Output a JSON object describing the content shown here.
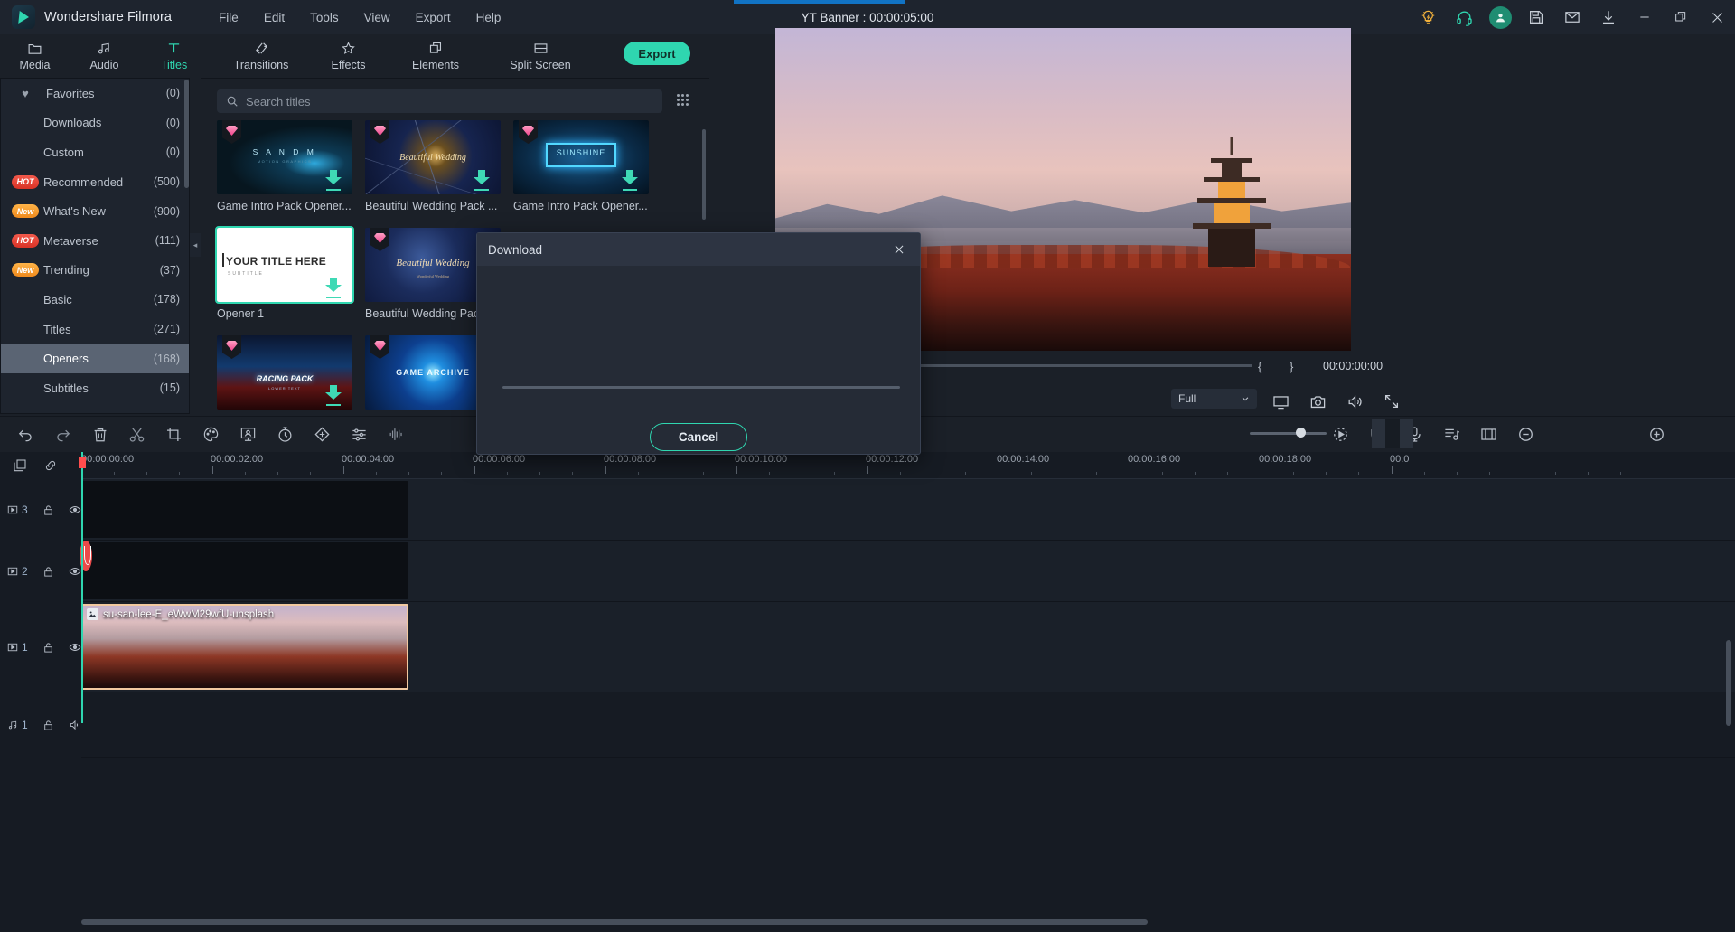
{
  "app": {
    "name": "Wondershare Filmora",
    "logo_icon": "filmora-dart-icon",
    "project_title": "YT Banner : 00:00:05:00"
  },
  "menubar": {
    "items": [
      {
        "label": "File",
        "name": "menu-file"
      },
      {
        "label": "Edit",
        "name": "menu-edit"
      },
      {
        "label": "Tools",
        "name": "menu-tools"
      },
      {
        "label": "View",
        "name": "menu-view"
      },
      {
        "label": "Export",
        "name": "menu-export"
      },
      {
        "label": "Help",
        "name": "menu-help"
      }
    ]
  },
  "titlebar_icons": [
    {
      "name": "tips-lightbulb-icon",
      "color": "#f0b03c"
    },
    {
      "name": "headset-support-icon",
      "color": "#2fd6b0"
    },
    {
      "name": "user-account-icon",
      "color": "#1f8d72"
    },
    {
      "name": "save-project-icon",
      "color": "#c9d0d9"
    },
    {
      "name": "mail-icon",
      "color": "#c9d0d9"
    },
    {
      "name": "download-icon",
      "color": "#c9d0d9"
    },
    {
      "name": "minimize-icon",
      "color": "#c9d0d9"
    },
    {
      "name": "maximize-icon",
      "color": "#c9d0d9"
    },
    {
      "name": "close-icon",
      "color": "#c9d0d9"
    }
  ],
  "ribbon": {
    "tabs": [
      {
        "label": "Media",
        "icon": "folder-icon",
        "active": false
      },
      {
        "label": "Audio",
        "icon": "music-note-icon",
        "active": false
      },
      {
        "label": "Titles",
        "icon": "text-t-icon",
        "active": true
      },
      {
        "label": "Transitions",
        "icon": "transitions-arrows-icon",
        "active": false
      },
      {
        "label": "Effects",
        "icon": "effects-star-icon",
        "active": false
      },
      {
        "label": "Elements",
        "icon": "elements-layers-icon",
        "active": false
      },
      {
        "label": "Split Screen",
        "icon": "split-screen-icon",
        "active": false
      }
    ],
    "export_button": "Export",
    "accent_color": "#2fd6b0"
  },
  "sidebar": {
    "items": [
      {
        "label": "Favorites",
        "count": "(0)",
        "badge": "",
        "icon": "heart-icon",
        "selected": false
      },
      {
        "label": "Downloads",
        "count": "(0)",
        "badge": "",
        "icon": "",
        "selected": false
      },
      {
        "label": "Custom",
        "count": "(0)",
        "badge": "",
        "icon": "",
        "selected": false
      },
      {
        "label": "Recommended",
        "count": "(500)",
        "badge": "HOT",
        "icon": "",
        "selected": false
      },
      {
        "label": "What's New",
        "count": "(900)",
        "badge": "New",
        "icon": "",
        "selected": false
      },
      {
        "label": "Metaverse",
        "count": "(111)",
        "badge": "HOT",
        "icon": "",
        "selected": false
      },
      {
        "label": "Trending",
        "count": "(37)",
        "badge": "New",
        "icon": "",
        "selected": false
      },
      {
        "label": "Basic",
        "count": "(178)",
        "badge": "",
        "icon": "",
        "selected": false
      },
      {
        "label": "Titles",
        "count": "(271)",
        "badge": "",
        "icon": "",
        "selected": false
      },
      {
        "label": "Openers",
        "count": "(168)",
        "badge": "",
        "icon": "",
        "selected": true
      },
      {
        "label": "Subtitles",
        "count": "(15)",
        "badge": "",
        "icon": "",
        "selected": false
      }
    ],
    "badge_colors": {
      "hot": "#e23b2c",
      "new": "#f4992a"
    },
    "selected_bg": "#5a6473",
    "collapse_icon": "chevron-left-icon"
  },
  "library": {
    "search_placeholder": "Search titles",
    "search_value": "",
    "search_icon": "search-icon",
    "grid_view_icon": "grid-view-icon",
    "items": [
      {
        "caption": "Game Intro Pack Opener...",
        "art": "art-sandom",
        "premium": true,
        "downloadable": true,
        "selected": false
      },
      {
        "caption": "Beautiful Wedding Pack ...",
        "art": "art-wed1",
        "premium": true,
        "downloadable": true,
        "selected": false
      },
      {
        "caption": "Game Intro Pack Opener...",
        "art": "art-sun",
        "premium": true,
        "downloadable": true,
        "selected": false
      },
      {
        "caption": "Opener 1",
        "art": "art-white",
        "premium": false,
        "downloadable": true,
        "selected": true
      },
      {
        "caption": "Beautiful Wedding Pac",
        "art": "art-wed2",
        "premium": true,
        "downloadable": false,
        "selected": false
      },
      {
        "caption": "",
        "art": "art-racing",
        "premium": true,
        "downloadable": true,
        "selected": false
      },
      {
        "caption": "",
        "art": "art-gamearc",
        "premium": true,
        "downloadable": false,
        "selected": false
      }
    ],
    "thumb_texts": {
      "sandom": "S A N D M",
      "sandom_sub": "MOTION GRAPHICS",
      "wedding_script": "Beautiful Wedding",
      "wedding_sub": "Wonderful Wedding",
      "sunshine": "SUNSHINE",
      "your_title": "YOUR TITLE HERE",
      "your_title_sub": "SUBTITLE",
      "racing": "RACING PACK",
      "racing_sub": "LOWER TEXT",
      "game_archive": "GAME ARCHIVE"
    }
  },
  "dialog": {
    "title": "Download",
    "cancel_label": "Cancel",
    "close_icon": "close-icon",
    "progress_percent": 0
  },
  "preview": {
    "time_current": "00:00:00:00",
    "bracket_in": "{",
    "bracket_out": "}",
    "quality_label": "Full",
    "quality_caret": "chevron-down-icon",
    "controls": [
      {
        "name": "fullscreen-preview-icon"
      },
      {
        "name": "snapshot-camera-icon"
      },
      {
        "name": "volume-icon"
      },
      {
        "name": "expand-arrows-icon"
      }
    ]
  },
  "timeline_toolbar": {
    "left_tools": [
      {
        "name": "undo-icon"
      },
      {
        "name": "redo-icon"
      },
      {
        "name": "delete-trash-icon"
      },
      {
        "name": "split-scissors-icon"
      },
      {
        "name": "crop-icon"
      },
      {
        "name": "color-palette-icon"
      },
      {
        "name": "green-screen-icon"
      },
      {
        "name": "speed-timer-icon"
      },
      {
        "name": "keyframe-diamond-icon"
      },
      {
        "name": "audio-mixer-icon"
      },
      {
        "name": "audio-waveform-icon"
      }
    ],
    "right_tools": [
      {
        "name": "render-preview-icon"
      },
      {
        "name": "marker-shield-icon"
      },
      {
        "name": "record-voiceover-icon"
      },
      {
        "name": "auto-beat-sync-icon"
      },
      {
        "name": "fit-timeline-icon"
      },
      {
        "name": "zoom-out-icon"
      },
      {
        "name": "zoom-in-icon"
      }
    ],
    "zoom_value": 60
  },
  "timeline": {
    "ruler_labels": [
      "00:00:00:00",
      "00:00:02:00",
      "00:00:04:00",
      "00:00:06:00",
      "00:00:08:00",
      "00:00:10:00",
      "00:00:12:00",
      "00:00:14:00",
      "00:00:16:00",
      "00:00:18:00",
      "00:0"
    ],
    "tracks": [
      {
        "number": "3",
        "type": "video",
        "lock_icon": "unlock-icon",
        "eye_icon": "eye-icon",
        "has_clip": true,
        "clip_label": "",
        "clip_kind": "empty"
      },
      {
        "number": "2",
        "type": "video",
        "lock_icon": "unlock-icon",
        "eye_icon": "eye-icon",
        "has_clip": true,
        "clip_label": "",
        "clip_kind": "empty"
      },
      {
        "number": "1",
        "type": "video",
        "lock_icon": "unlock-icon",
        "eye_icon": "eye-icon",
        "has_clip": true,
        "clip_label": "su-san-lee-E_eWwM29wfU-unsplash",
        "clip_kind": "image"
      },
      {
        "number": "1",
        "type": "audio",
        "lock_icon": "unlock-icon",
        "eye_icon": "mute-speaker-icon",
        "has_clip": false,
        "clip_label": "",
        "clip_kind": "none"
      }
    ],
    "playhead_color": "#2fd6b0",
    "clip_border_color": "#f2c9a0"
  }
}
